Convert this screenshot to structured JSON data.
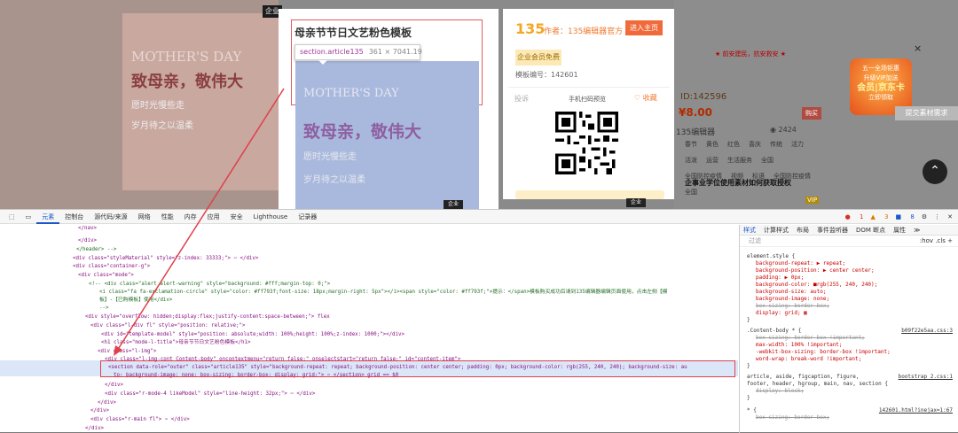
{
  "left_poster": {
    "badge": "企业",
    "en": "MOTHER'S DAY",
    "cn": "致母亲，敬伟大",
    "sub1": "愿时光慢些走",
    "sub2": "岁月待之以温柔"
  },
  "preview": {
    "title": "母亲节节日文艺粉色模板",
    "tooltip_selector": "section.article135",
    "tooltip_size": "361 × 7041.19",
    "poster_en": "MOTHER'S DAY",
    "poster_cn": "致母亲，敬伟大",
    "poster_sub1": "愿时光慢些走",
    "poster_sub2": "岁月待之以温柔",
    "badge": "企业"
  },
  "info": {
    "logo": "135",
    "author": "作者：135编辑器官方",
    "home_button": "进入主页",
    "free_button": "企业会员免费",
    "template_no": "模板编号：142601",
    "report": "投诉",
    "mobile_preview": "手机扫码预览",
    "favorite": "♡ 收藏"
  },
  "right": {
    "red_line": "★ 前安建民，抗安救安 ★",
    "id": "ID:142596",
    "price": "¥8.00",
    "buy": "购买",
    "editor": "135编辑器",
    "views": "◉ 2424",
    "tags": [
      "春节",
      "黄色",
      "红色",
      "喜庆",
      "传统",
      "活力",
      "活泼",
      "运营",
      "生活服务",
      "全国",
      "全国防控疫情",
      "视频",
      "标语",
      "全国防控疫情",
      "全国"
    ],
    "service": "企事业学位使用素材如何获取授权",
    "vip": "VIP"
  },
  "promo": {
    "line1": "五一全场钜惠",
    "line2": "升级VIP加送",
    "line3": "会员|京东卡",
    "line4": "立即领取",
    "close": "×"
  },
  "request_button": "提交素材需求",
  "top_button": "⌃",
  "devtools": {
    "tabs": [
      "元素",
      "控制台",
      "源代码/来源",
      "网络",
      "性能",
      "内存",
      "应用",
      "安全",
      "Lighthouse",
      "记录器"
    ],
    "errors": "1",
    "warnings": "3",
    "infos": "8",
    "lines": [
      "</nav>",
      "</div>",
      "</header> -->",
      "<div class=\"styleMaterial\" style=\"z-index: 33333;\"> ⋯ </div>",
      "<div class=\"container-g\">",
      "<div class=\"mode\">",
      "<!--    <div class=\"alert alert-warning\" style=\"background: #fff;margin-top: 0;\">",
      "<i class=\"fa fa-exclamation-circle\" style=\"color: #ff793f;font-size: 18px;margin-right: 5px\"></i><span style=\"color: #ff793f;\">提示：</span>模板购买成功后请到135编辑器编辑页面使用，点击左侧【模",
      "板】-【已购模板】使用</div>",
      "-->",
      "<div style=\"overflow: hidden;display:flex;justify-content:space-between;\"> flex",
      "<div class=\"l-div fl\" style=\"position: relative;\">",
      "<div id=\"template-model\" style=\"position: absolute;width: 100%;height: 100%;z-index: 1000;\"></div>",
      "<h1 class=\"mode-l-title\">母亲节节日文艺粉色模板</h1>",
      "<div class=\"l-img\">",
      "<div class=\"l-img-cont Content-body\" oncontextmenu=\"return false;\" onselectstart=\"return false;\" id=\"content-item\">",
      "<section data-role=\"outer\" class=\"article135\" style=\"background-repeat: repeat; background-position: center center; padding: 0px; background-color: rgb(255, 240, 240); background-size: au",
      "to; background-image: none; box-sizing: border-box; display: grid;\"> ⋯ </section> grid == $0",
      "</div>",
      "<div class=\"r-mode-4 likeModel\" style=\"line-height: 32px;\"> ⋯ </div>",
      "</div>",
      "</div>",
      "<div class=\"r-main fl\"> ⋯ </div>",
      "</div>"
    ],
    "styles_tabs": [
      "样式",
      "计算样式",
      "布局",
      "事件监听器",
      "DOM 断点",
      "属性",
      "≫"
    ],
    "filter_placeholder": "过滤",
    "filter_controls": ":hov  .cls  +",
    "style_lines": [
      "element.style {",
      "background-repeat: ▶ repeat;",
      "background-position: ▶ center center;",
      "padding: ▶ 0px;",
      "background-color: ■rgb(255, 240, 240);",
      "background-size: auto;",
      "background-image: none;",
      "box-sizing: border-box;",
      "display: grid; ▦",
      "}",
      ".Content-body * {",
      "box-sizing: border-box !important;",
      "max-width: 100% !important;",
      "-webkit-box-sizing: border-box !important;",
      "word-wrap: break-word !important;",
      "}",
      "article, aside, figcaption, figure,",
      "footer, header, hgroup, main, nav, section {",
      "display: block;",
      "}",
      "* {",
      "box-sizing: border-box;"
    ],
    "links": [
      "b09f22e5aa.css:3",
      "bootstrap_2.css:1",
      "142601.html?inejax=1:67"
    ]
  }
}
